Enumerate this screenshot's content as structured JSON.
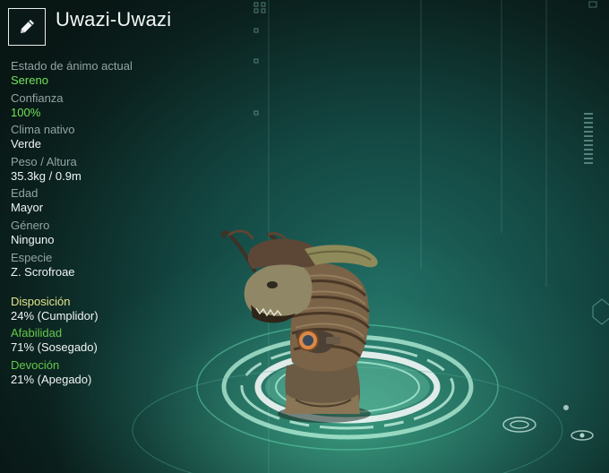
{
  "pet": {
    "name": "Uwazi-Uwazi"
  },
  "edit_icon": "pencil-icon",
  "stats": [
    {
      "label": "Estado de ánimo actual",
      "value": "Sereno"
    },
    {
      "label": "Confianza",
      "value": "100%"
    },
    {
      "label": "Clima nativo",
      "value": "Verde"
    },
    {
      "label": "Peso / Altura",
      "value": "35.3kg / 0.9m"
    },
    {
      "label": "Edad",
      "value": "Mayor"
    },
    {
      "label": "Género",
      "value": "Ninguno"
    },
    {
      "label": "Especie",
      "value": "Z. Scrofroae"
    }
  ],
  "traits": [
    {
      "label": "Disposición",
      "value": "24% (Cumplidor)",
      "level": 0.24
    },
    {
      "label": "Afabilidad",
      "value": "71% (Sosegado)",
      "level": 0.71
    },
    {
      "label": "Devoción",
      "value": "21% (Apegado)",
      "level": 0.21
    }
  ],
  "colors": {
    "accent_green": "#74e35a",
    "trait_yellow": "#e2e68a",
    "trait_green": "#63c94a",
    "label_gray": "#93a4a3",
    "value_white": "#f0f4f4"
  }
}
